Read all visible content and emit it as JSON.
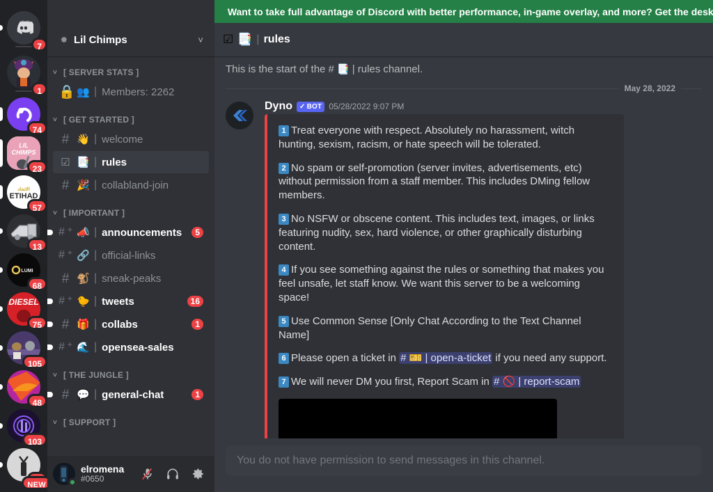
{
  "promo": {
    "text": "Want to take full advantage of Discord with better performance, in-game overlay, and more? Get the desktop app",
    "color": "#248046"
  },
  "server_rail": {
    "items": [
      {
        "name": "home-discord",
        "label": "",
        "badge": "7",
        "pill": "none",
        "shape": "circle",
        "icon": "discord-logo-icon",
        "bg": "#36393f"
      },
      {
        "name": "roblox-avatar-server",
        "label": "",
        "badge": "1",
        "pill": "none",
        "shape": "circle",
        "icon": "avatar-image",
        "bg": "#2b2f36"
      },
      {
        "name": "purple-server",
        "label": "",
        "badge": "74",
        "pill": "small",
        "shape": "circle",
        "icon": "purple-logo",
        "bg": "#7b3ff2"
      },
      {
        "name": "lil-chimps-server",
        "label": "LIL CHIMPS",
        "badge": "23",
        "pill": "selected",
        "shape": "squircle",
        "icon": "lil-chimps-logo",
        "bg": "#e9a2b8"
      },
      {
        "name": "etihad-server",
        "label": "ETIHAD",
        "badge": "57",
        "pill": "small",
        "shape": "circle",
        "icon": "etihad-logo",
        "bg": "#ffffff"
      },
      {
        "name": "truck-server",
        "label": "",
        "badge": "13",
        "pill": "small",
        "shape": "circle",
        "icon": "truck-logo",
        "bg": "#2e3034"
      },
      {
        "name": "lumishare-server",
        "label": "LUMISHARE",
        "badge": "68",
        "pill": "small",
        "shape": "circle",
        "icon": "lumishare-logo",
        "bg": "#0a0a0a"
      },
      {
        "name": "diesel-server",
        "label": "DIESEL",
        "badge": "75",
        "pill": "small",
        "shape": "circle",
        "icon": "diesel-logo",
        "bg": "#d62128"
      },
      {
        "name": "cats-server",
        "label": "",
        "badge": "105",
        "pill": "small",
        "shape": "circle",
        "icon": "cats-logo",
        "bg": "#4a3a6b"
      },
      {
        "name": "orange-swoosh-server",
        "label": "",
        "badge": "48",
        "pill": "small",
        "shape": "circle",
        "icon": "swoosh-logo",
        "bg": "#b5259e"
      },
      {
        "name": "purple-radio-server",
        "label": "",
        "badge": "103",
        "pill": "small",
        "shape": "circle",
        "icon": "radio-logo",
        "bg": "#1b1030"
      },
      {
        "name": "white-figure-server",
        "label": "",
        "badge": "30",
        "pill": "small",
        "shape": "circle",
        "icon": "figure-logo",
        "bg": "#d8d8d8"
      },
      {
        "name": "new-server",
        "label": "NEW",
        "badge": "",
        "pill": "none",
        "shape": "circle",
        "icon": "new-badge",
        "bg": "#e8e8e8"
      }
    ]
  },
  "sidebar": {
    "server_name": "Lil Chimps",
    "server_icon": "gear-icon",
    "dropdown_icon": "chevron-down-icon",
    "categories": [
      {
        "label": "[ SERVER STATS ]",
        "channels": [
          {
            "name": "members-count",
            "icon": "lock-icon",
            "emoji": "👥",
            "label": "Members: 2262",
            "badge": "",
            "unread": false,
            "active": false,
            "dot": false
          }
        ]
      },
      {
        "label": "[ GET STARTED ]",
        "channels": [
          {
            "name": "welcome",
            "icon": "hash-icon",
            "emoji": "👋",
            "label": "welcome",
            "badge": "",
            "unread": false,
            "active": false,
            "dot": false
          },
          {
            "name": "rules",
            "icon": "checkbox-icon",
            "emoji": "📑",
            "label": "rules",
            "badge": "",
            "unread": false,
            "active": true,
            "dot": false
          },
          {
            "name": "collabland-join",
            "icon": "hash-icon",
            "emoji": "🎉",
            "label": "collabland-join",
            "badge": "",
            "unread": false,
            "active": false,
            "dot": false
          }
        ]
      },
      {
        "label": "[ IMPORTANT ]",
        "channels": [
          {
            "name": "announcements",
            "icon": "hash-announce-icon",
            "emoji": "📣",
            "label": "announcements",
            "badge": "5",
            "unread": true,
            "active": false,
            "dot": true
          },
          {
            "name": "official-links",
            "icon": "hash-announce-icon",
            "emoji": "🔗",
            "label": "official-links",
            "badge": "",
            "unread": false,
            "active": false,
            "dot": false
          },
          {
            "name": "sneak-peaks",
            "icon": "hash-icon",
            "emoji": "🐒",
            "label": "sneak-peaks",
            "badge": "",
            "unread": false,
            "active": false,
            "dot": false
          },
          {
            "name": "tweets",
            "icon": "hash-announce-icon",
            "emoji": "🐤",
            "label": "tweets",
            "badge": "16",
            "unread": true,
            "active": false,
            "dot": true
          },
          {
            "name": "collabs",
            "icon": "hash-icon",
            "emoji": "🎁",
            "label": "collabs",
            "badge": "1",
            "unread": true,
            "active": false,
            "dot": true
          },
          {
            "name": "opensea-sales",
            "icon": "hash-announce-icon",
            "emoji": "🌊",
            "label": "opensea-sales",
            "badge": "",
            "unread": true,
            "active": false,
            "dot": true
          }
        ]
      },
      {
        "label": "[ THE JUNGLE ]",
        "channels": [
          {
            "name": "general-chat",
            "icon": "hash-icon",
            "emoji": "💬",
            "label": "general-chat",
            "badge": "1",
            "unread": true,
            "active": false,
            "dot": true
          }
        ]
      },
      {
        "label": "[ SUPPORT ]",
        "channels": []
      }
    ]
  },
  "user_panel": {
    "username": "elromena",
    "discriminator": "#0650",
    "status": "online",
    "mute_icon": "microphone-muted-icon",
    "deafen_icon": "headphones-icon",
    "settings_icon": "gear-icon"
  },
  "header": {
    "checkbox_icon": "checkbox-icon",
    "emoji": "📑",
    "separator": "|",
    "title": "rules"
  },
  "main": {
    "start_text_a": "This is the start of the #",
    "start_emoji": "📑",
    "start_text_b": "|  rules channel.",
    "date_divider": "May 28, 2022",
    "message": {
      "author": "Dyno",
      "bot_tag": "BOT",
      "bot_check": "✓",
      "timestamp": "05/28/2022 9:07 PM",
      "avatar_icon": "dyno-logo-icon",
      "accent_color": "#ed4245",
      "rules": [
        {
          "num": "1",
          "parts": [
            {
              "t": "text",
              "v": "Treat everyone with respect. Absolutely no harassment, witch hunting, sexism, racism, or hate speech will be tolerated."
            }
          ]
        },
        {
          "num": "2",
          "parts": [
            {
              "t": "text",
              "v": "No spam or self-promotion (server invites, advertisements, etc) without permission from a staff member. This includes DMing fellow members."
            }
          ]
        },
        {
          "num": "3",
          "parts": [
            {
              "t": "text",
              "v": "No NSFW or obscene content. This includes text, images, or links featuring nudity, sex, hard violence, or other graphically disturbing content."
            }
          ]
        },
        {
          "num": "4",
          "parts": [
            {
              "t": "text",
              "v": "If you see something against the rules or something that makes you feel unsafe, let staff know. We want this server to be a welcoming space!"
            }
          ]
        },
        {
          "num": "5",
          "parts": [
            {
              "t": "text",
              "v": "Use Common Sense [Only Chat According to the Text Channel Name]"
            }
          ]
        },
        {
          "num": "6",
          "parts": [
            {
              "t": "text",
              "v": "Please open a ticket in "
            },
            {
              "t": "mention",
              "v": "# 🎫  |  open-a-ticket"
            },
            {
              "t": "text",
              "v": " if you need any support."
            }
          ]
        },
        {
          "num": "7",
          "parts": [
            {
              "t": "text",
              "v": "We will never DM you first, Report Scam in "
            },
            {
              "t": "mention",
              "v": "# 🚫  |  report-scam"
            }
          ]
        }
      ]
    }
  },
  "composer": {
    "placeholder": "You do not have permission to send messages in this channel."
  }
}
